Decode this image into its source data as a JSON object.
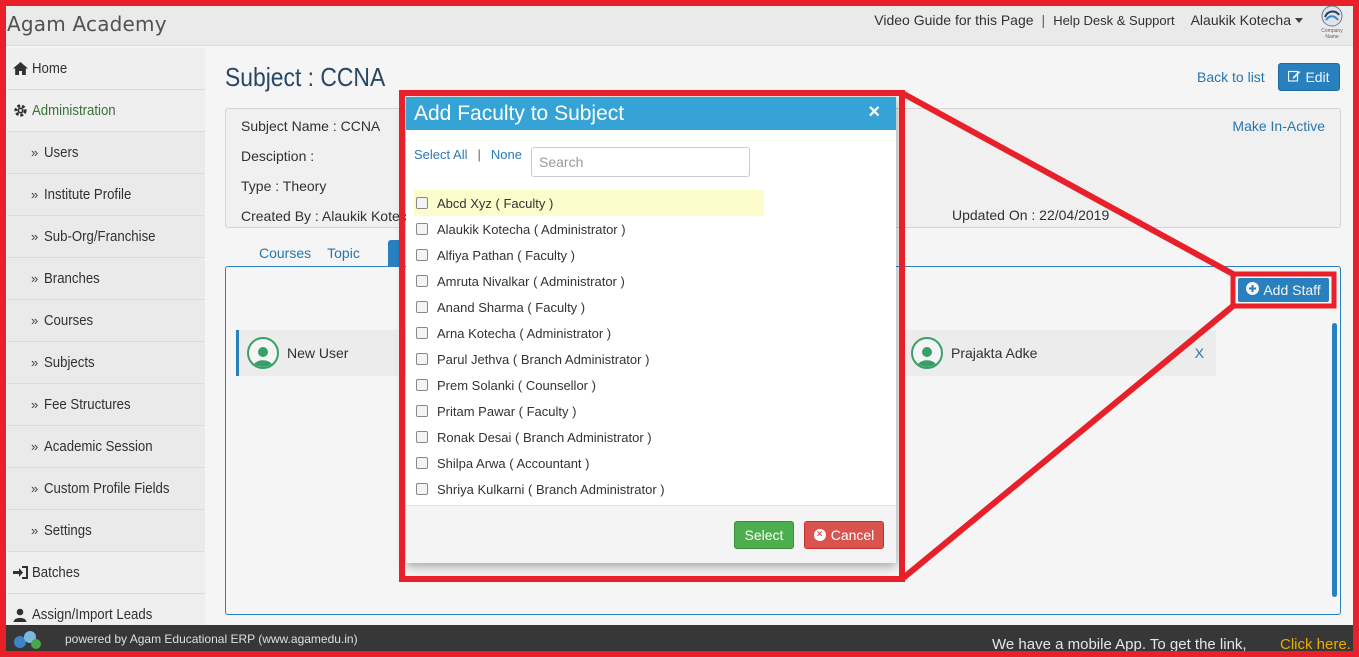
{
  "header": {
    "brand": "Agam Academy",
    "video_guide": "Video Guide for this Page",
    "separator": "|",
    "help_desk": "Help Desk & Support",
    "user_name": "Alaukik Kotecha",
    "logo_caption": "Company Name"
  },
  "sidebar": {
    "items": [
      {
        "label": "Home",
        "icon": "home-icon",
        "level": "top"
      },
      {
        "label": "Administration",
        "icon": "gear-icon",
        "level": "top",
        "active": true
      },
      {
        "label": "Users",
        "level": "sub"
      },
      {
        "label": "Institute Profile",
        "level": "sub"
      },
      {
        "label": "Sub-Org/Franchise",
        "level": "sub"
      },
      {
        "label": "Branches",
        "level": "sub"
      },
      {
        "label": "Courses",
        "level": "sub"
      },
      {
        "label": "Subjects",
        "level": "sub"
      },
      {
        "label": "Fee Structures",
        "level": "sub"
      },
      {
        "label": "Academic Session",
        "level": "sub"
      },
      {
        "label": "Custom Profile Fields",
        "level": "sub"
      },
      {
        "label": "Settings",
        "level": "sub"
      },
      {
        "label": "Batches",
        "icon": "sign-in-icon",
        "level": "top"
      },
      {
        "label": "Assign/Import Leads",
        "icon": "user-icon",
        "level": "top"
      }
    ]
  },
  "main": {
    "title": "Subject : CCNA",
    "back_to_list": "Back to list",
    "edit_label": "Edit",
    "make_inactive": "Make In-Active",
    "info": {
      "subject_name": "Subject Name : CCNA",
      "description": "Desciption :",
      "type": "Type : Theory",
      "created_by": "Created By : Alaukik Kotec",
      "updated_on": "Updated On : 22/04/2019"
    },
    "tabs": [
      {
        "label": "Courses"
      },
      {
        "label": "Topic"
      }
    ],
    "add_staff": "Add Staff",
    "staff": [
      {
        "name": "New User"
      },
      {
        "name": "Prajakta Adke",
        "remove": "X"
      }
    ]
  },
  "modal": {
    "title": "Add Faculty to Subject",
    "close": "×",
    "select_all": "Select All",
    "tool_sep": "|",
    "none": "None",
    "search_placeholder": "Search",
    "faculty": [
      "Abcd Xyz ( Faculty )",
      "Alaukik Kotecha ( Administrator )",
      "Alfiya Pathan ( Faculty )",
      "Amruta Nivalkar ( Administrator )",
      "Anand Sharma ( Faculty )",
      "Arna Kotecha ( Administrator )",
      "Parul Jethva ( Branch Administrator )",
      "Prem Solanki ( Counsellor )",
      "Pritam Pawar ( Faculty )",
      "Ronak Desai ( Branch Administrator )",
      "Shilpa Arwa ( Accountant )",
      "Shriya Kulkarni ( Branch Administrator )"
    ],
    "select_label": "Select",
    "cancel_label": "Cancel"
  },
  "footer": {
    "powered_by": "powered by Agam Educational ERP (www.agamedu.in)",
    "mobile_app": "We have a mobile App. To get the link,",
    "click_here": "Click here."
  },
  "colors": {
    "accent": "#2a86c7",
    "modal_header": "#36a3d6",
    "annotation": "#e8202a",
    "success": "#4cae4c",
    "danger": "#d9534f"
  }
}
